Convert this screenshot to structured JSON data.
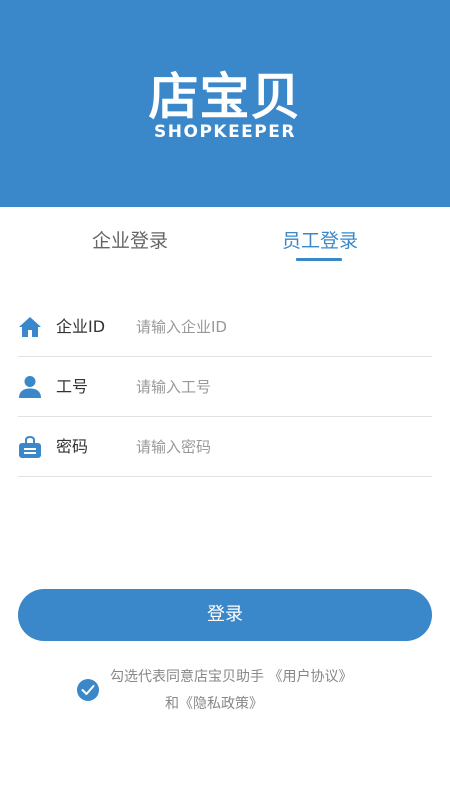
{
  "header": {
    "logo_cn": "店宝贝",
    "logo_en": "SHOPKEEPER",
    "background_color": "#3a87c9"
  },
  "tabs": [
    {
      "label": "企业登录",
      "selected": false
    },
    {
      "label": "员工登录",
      "selected": true
    }
  ],
  "form": {
    "fields": [
      {
        "icon": "home-icon",
        "label": "企业ID",
        "placeholder": "请输入企业ID",
        "value": ""
      },
      {
        "icon": "user-icon",
        "label": "工号",
        "placeholder": "请输入工号",
        "value": ""
      },
      {
        "icon": "lock-icon",
        "label": "密码",
        "placeholder": "请输入密码",
        "value": ""
      }
    ]
  },
  "login_button": {
    "label": "登录"
  },
  "agreement": {
    "checked": true,
    "prefix": "勾选代表同意店宝贝助手",
    "user_agreement": "《用户协议》",
    "joiner": "和",
    "privacy_policy": "《隐私政策》"
  },
  "accent_color": "#3a87c9"
}
